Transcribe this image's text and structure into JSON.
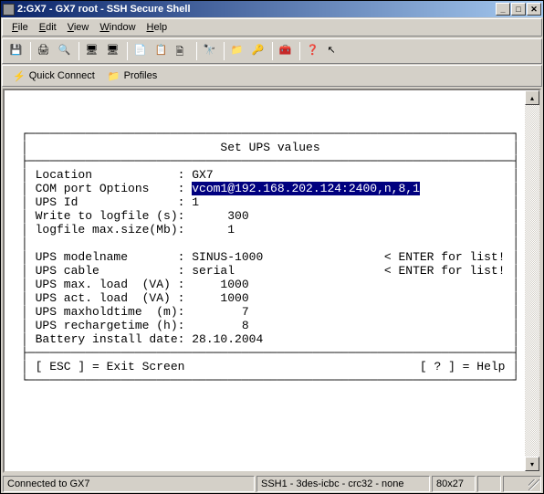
{
  "window": {
    "title": "2:GX7 - GX7 root - SSH Secure Shell"
  },
  "menu": {
    "file": "File",
    "edit": "Edit",
    "view": "View",
    "window": "Window",
    "help": "Help"
  },
  "connbar": {
    "quick": "Quick Connect",
    "profiles": "Profiles"
  },
  "term": {
    "header": "Set UPS values",
    "rows": [
      {
        "label": "Location            : ",
        "value": "GX7",
        "hint": ""
      },
      {
        "label": "COM port Options    : ",
        "value": "vcom1@192.168.202.124:2400,n,8,1",
        "hint": "",
        "highlight": true
      },
      {
        "label": "UPS Id              : ",
        "value": "1",
        "hint": ""
      },
      {
        "label": "Write to logfile (s): ",
        "value": "     300",
        "hint": ""
      },
      {
        "label": "logfile max.size(Mb): ",
        "value": "     1",
        "hint": ""
      },
      {
        "label": "",
        "value": "",
        "hint": ""
      },
      {
        "label": "UPS modelname       : ",
        "value": "SINUS-1000",
        "hint": "< ENTER for list!"
      },
      {
        "label": "UPS cable           : ",
        "value": "serial",
        "hint": "< ENTER for list!"
      },
      {
        "label": "UPS max. load  (VA) : ",
        "value": "    1000",
        "hint": ""
      },
      {
        "label": "UPS act. load  (VA) : ",
        "value": "    1000",
        "hint": ""
      },
      {
        "label": "UPS maxholdtime  (m): ",
        "value": "       7",
        "hint": ""
      },
      {
        "label": "UPS rechargetime (h): ",
        "value": "       8",
        "hint": ""
      },
      {
        "label": "Battery install date: ",
        "value": "28.10.2004",
        "hint": ""
      }
    ],
    "footer_left": "[ ESC ] = Exit Screen",
    "footer_right": "[ ? ] = Help"
  },
  "status": {
    "conn": "Connected to GX7",
    "proto": "SSH1 - 3des-icbc - crc32 - none",
    "size": "80x27"
  },
  "icons": {
    "save": "💾",
    "print": "🖨",
    "preview": "🔍",
    "term1": "🖥",
    "term2": "🖥",
    "copy": "📄",
    "paste": "📋",
    "new": "🗎",
    "find": "🔭",
    "folder": "📁",
    "key": "🔑",
    "settings": "🧰",
    "help": "❓",
    "arrow": "↖",
    "qc": "⚡",
    "prof": "📁"
  }
}
